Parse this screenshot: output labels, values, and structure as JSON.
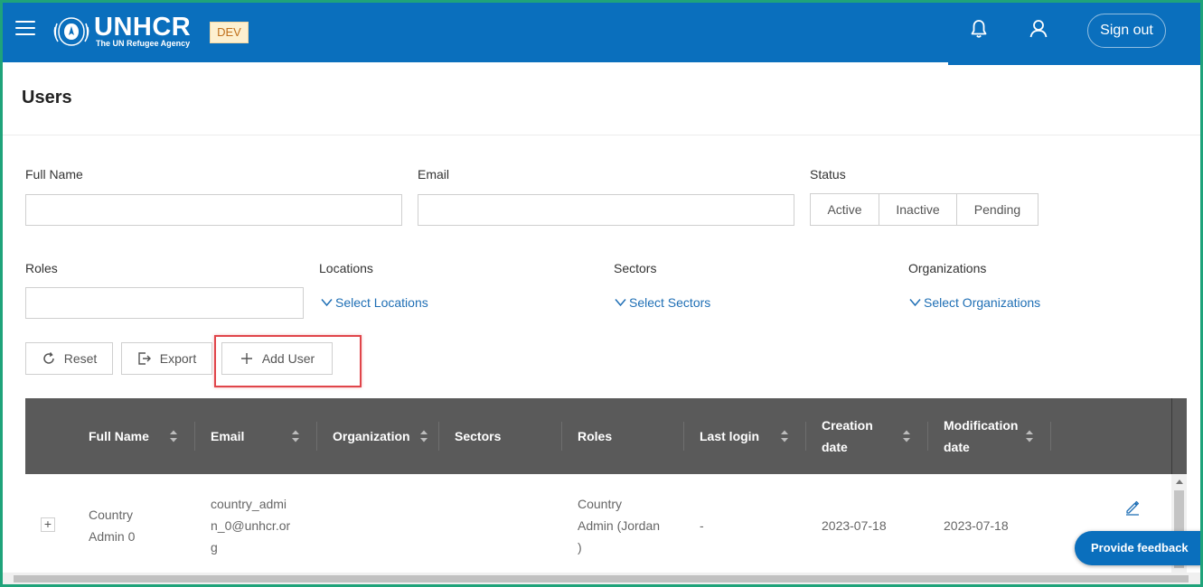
{
  "header": {
    "brand": "UNHCR",
    "tagline": "The UN Refugee Agency",
    "env_badge": "DEV",
    "sign_out_label": "Sign out"
  },
  "page": {
    "title": "Users"
  },
  "filters": {
    "full_name": {
      "label": "Full Name",
      "value": ""
    },
    "email": {
      "label": "Email",
      "value": ""
    },
    "status": {
      "label": "Status",
      "options": [
        "Active",
        "Inactive",
        "Pending"
      ]
    },
    "roles": {
      "label": "Roles",
      "value": ""
    },
    "locations": {
      "label": "Locations",
      "select_label": "Select Locations"
    },
    "sectors": {
      "label": "Sectors",
      "select_label": "Select Sectors"
    },
    "organizations": {
      "label": "Organizations",
      "select_label": "Select Organizations"
    }
  },
  "actions": {
    "reset_label": "Reset",
    "export_label": "Export",
    "add_user_label": "Add User"
  },
  "table": {
    "columns": [
      {
        "label": "Full Name",
        "sortable": true
      },
      {
        "label": "Email",
        "sortable": true
      },
      {
        "label": "Organization",
        "sortable": true
      },
      {
        "label": "Sectors",
        "sortable": false
      },
      {
        "label": "Roles",
        "sortable": false
      },
      {
        "label": "Last login",
        "sortable": true
      },
      {
        "label": "Creation date",
        "sortable": true
      },
      {
        "label": "Modification date",
        "sortable": true
      }
    ],
    "rows": [
      {
        "full_name": [
          "Country",
          "Admin 0"
        ],
        "email": [
          "country_admi",
          "n_0@unhcr.or",
          "g"
        ],
        "organization": "",
        "sectors": "",
        "roles": [
          "Country",
          "Admin (Jordan",
          ")"
        ],
        "last_login": "-",
        "creation_date": "2023-07-18",
        "modification_date": "2023-07-18",
        "expand_symbol": "+"
      }
    ]
  },
  "feedback_label": "Provide feedback",
  "colors": {
    "primary": "#0a6fbd",
    "table_header": "#5a5a5a",
    "link": "#1f6fb5",
    "highlight": "#e0454a",
    "dev_badge_bg": "#fdf0d0"
  }
}
